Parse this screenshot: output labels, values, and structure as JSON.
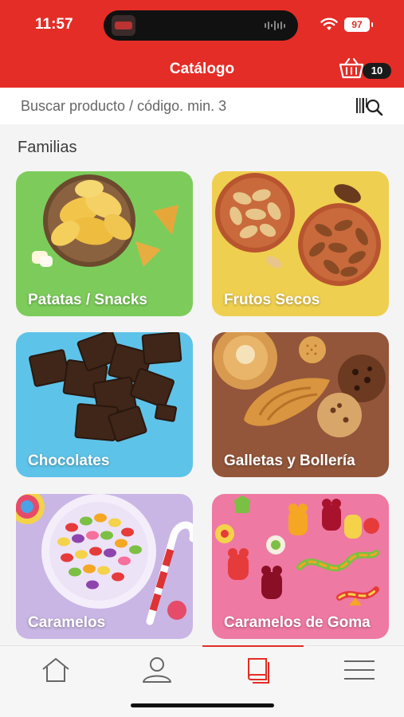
{
  "status_bar": {
    "time": "11:57",
    "battery": "97",
    "icons": [
      "wifi-icon",
      "battery-icon"
    ]
  },
  "header": {
    "title": "Catálogo",
    "cart_count": "10",
    "cart_icon": "basket-icon",
    "color": "#e42d26"
  },
  "search": {
    "placeholder": "Buscar producto / código. min. 3",
    "value": "",
    "scan_icon": "barcode-scan-icon"
  },
  "families": {
    "title": "Familias",
    "items": [
      {
        "label": "Patatas / Snacks",
        "color": "#7dcc5b"
      },
      {
        "label": "Frutos Secos",
        "color": "#efcf4f"
      },
      {
        "label": "Chocolates",
        "color": "#5ec3e9"
      },
      {
        "label": "Galletas y Bollería",
        "color": "#93563a"
      },
      {
        "label": "Caramelos",
        "color": "#c9b6e4"
      },
      {
        "label": "Caramelos de Goma",
        "color": "#ee79a3"
      }
    ]
  },
  "tabbar": {
    "tabs": [
      {
        "name": "home-icon",
        "active": false
      },
      {
        "name": "profile-icon",
        "active": false
      },
      {
        "name": "catalog-icon",
        "active": true
      },
      {
        "name": "menu-icon",
        "active": false
      }
    ]
  }
}
